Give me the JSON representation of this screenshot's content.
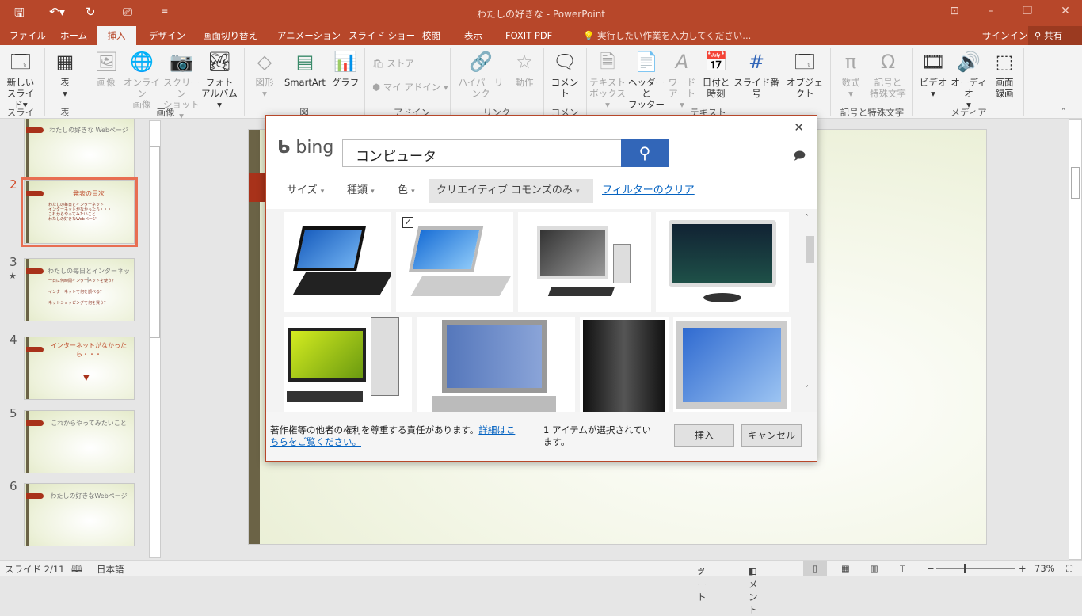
{
  "window": {
    "title": "わたしの好きな - PowerPoint"
  },
  "tabs": [
    "ファイル",
    "ホーム",
    "挿入",
    "デザイン",
    "画面切り替え",
    "アニメーション",
    "スライド ショー",
    "校閲",
    "表示",
    "FOXIT PDF"
  ],
  "active_tab": "挿入",
  "tell_me": "実行したい作業を入力してください...",
  "signin": "サインイン",
  "share": "共有",
  "ribbon": {
    "new_slide": [
      "新しい",
      "スライド"
    ],
    "table": "表",
    "image": "画像",
    "online_image": [
      "オンライン",
      "画像"
    ],
    "screenshot": [
      "スクリーン",
      "ショット"
    ],
    "photo_album": [
      "フォト",
      "アルバム"
    ],
    "shapes": "図形",
    "smartart": "SmartArt",
    "chart": "グラフ",
    "store": "ストア",
    "my_addins": "マイ アドイン",
    "hyperlink": "ハイパーリンク",
    "action": "動作",
    "comment": "コメント",
    "textbox": [
      "テキスト",
      "ボックス"
    ],
    "header_footer": [
      "ヘッダーと",
      "フッター"
    ],
    "wordart": [
      "ワード",
      "アート"
    ],
    "date_time": [
      "日付と",
      "時刻"
    ],
    "slide_number": "スライド番号",
    "object": "オブジェクト",
    "equation": "数式",
    "symbol": [
      "記号と",
      "特殊文字"
    ],
    "video": "ビデオ",
    "audio": "オーディオ",
    "screen_recording": [
      "画面",
      "録画"
    ],
    "groups": {
      "slides": "スライド",
      "tables": "表",
      "images": "画像",
      "illustrations": "図",
      "addins": "アドイン",
      "links": "リンク",
      "comments": "コメント",
      "text": "テキスト",
      "symbols": "記号と特殊文字",
      "media": "メディア"
    }
  },
  "thumbnails": [
    {
      "num": "",
      "title": "わたしの好きな Webページ",
      "bullets": []
    },
    {
      "num": "2",
      "title": "発表の目次",
      "bullets": [
        "わたしの毎日とインターネット",
        "インターネットがなかったら・・・",
        "これからやってみたいこと",
        "わたしの好きなWebページ"
      ]
    },
    {
      "num": "3",
      "title": "わたしの毎日とインターネット",
      "bullets": [
        "一日に何時間インターネットを使う？",
        "インターネットで何を調べる？",
        "ネットショッピングで何を買う？"
      ]
    },
    {
      "num": "4",
      "title": "インターネットがなかったら・・・",
      "bullets": [
        "",
        "",
        "",
        ""
      ]
    },
    {
      "num": "5",
      "title": "これからやってみたいこと",
      "bullets": [
        "",
        "",
        ""
      ]
    },
    {
      "num": "6",
      "title": "わたしの好きなWebページ",
      "bullets": [
        "",
        "",
        "",
        "",
        ""
      ]
    }
  ],
  "dialog": {
    "brand": "bing",
    "query": "コンピュータ",
    "filters": [
      "サイズ",
      "種類",
      "色",
      "クリエイティブ コモンズのみ"
    ],
    "clear_filters": "フィルターのクリア",
    "notice": "著作権等の他者の権利を尊重する責任があります。",
    "notice_link": "詳細はこちらをご覧ください。",
    "selection": "1 アイテムが選択されています。",
    "insert": "挿入",
    "cancel": "キャンセル"
  },
  "status": {
    "slide": "スライド 2/11",
    "language": "日本語",
    "notes": "ノート",
    "comments": "コメント",
    "zoom": "73%"
  },
  "zoom_percent": 73,
  "colors": {
    "accent": "#b7472a",
    "search": "#3266b8"
  }
}
